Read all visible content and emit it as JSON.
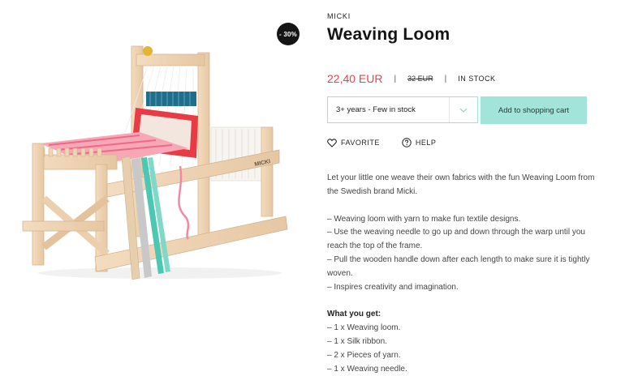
{
  "product": {
    "discount_badge": "- 30%",
    "brand": "MICKI",
    "title": "Weaving Loom",
    "price_current": "22,40 EUR",
    "price_old": "32 EUR",
    "separator": "|",
    "stock_status": "IN STOCK"
  },
  "purchase": {
    "variant_selected": "3+ years - Few in stock",
    "add_to_cart_label": "Add to shopping cart"
  },
  "actions": {
    "favorite_label": "FAVORITE",
    "help_label": "HELP"
  },
  "image": {
    "brand_mark": "MICKI"
  },
  "description": {
    "intro": "Let your little one weave their own fabrics with the fun Weaving Loom from the Swedish brand Micki.",
    "bullets": [
      "– Weaving loom with yarn to make fun textile designs.",
      "– Use the weaving needle to go up and down through the warp until you reach the top of the frame.",
      "– Pull the wooden handle down after each length to make sure it is tightly woven.",
      "– Inspires creativity and imagination."
    ],
    "contents_heading": "What you get:",
    "contents": [
      "– 1 x Weaving loom.",
      "– 1 x Silk ribbon.",
      "– 2 x Pieces of yarn.",
      "– 1 x Weaving needle."
    ]
  },
  "colors": {
    "price_red": "#e8424a",
    "accent_mint": "#a2e4d9",
    "select_border": "#9ee1d6",
    "badge_black": "#151515"
  }
}
